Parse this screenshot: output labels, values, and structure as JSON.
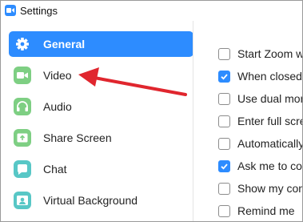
{
  "window": {
    "title": "Settings"
  },
  "sidebar": {
    "items": [
      {
        "label": "General",
        "icon": "gear-icon",
        "active": true
      },
      {
        "label": "Video",
        "icon": "video-camera-icon",
        "active": false
      },
      {
        "label": "Audio",
        "icon": "headphones-icon",
        "active": false
      },
      {
        "label": "Share Screen",
        "icon": "share-screen-icon",
        "active": false
      },
      {
        "label": "Chat",
        "icon": "chat-bubble-icon",
        "active": false
      },
      {
        "label": "Virtual Background",
        "icon": "virtual-background-icon",
        "active": false
      }
    ]
  },
  "options": [
    {
      "label": "Start Zoom wh",
      "checked": false
    },
    {
      "label": "When closed,",
      "checked": true
    },
    {
      "label": "Use dual mon",
      "checked": false
    },
    {
      "label": "Enter full scre",
      "checked": false
    },
    {
      "label": "Automatically",
      "checked": false
    },
    {
      "label": "Ask me to con",
      "checked": true
    },
    {
      "label": "Show my conn",
      "checked": false
    },
    {
      "label": "Remind me",
      "checked": false
    }
  ],
  "colors": {
    "accent": "#2d8cff",
    "icon_green": "#7ecf83",
    "annotation_arrow": "#e0262e"
  }
}
